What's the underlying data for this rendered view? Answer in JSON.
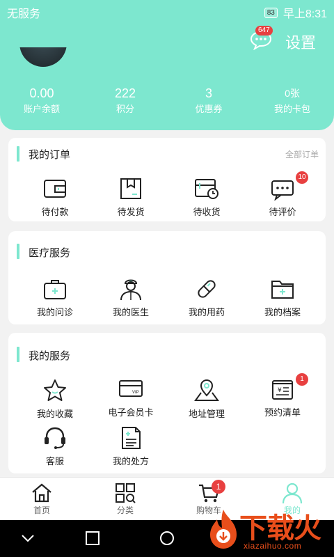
{
  "status_bar": {
    "carrier": "无服务",
    "battery": "83",
    "time": "早上8:31"
  },
  "header": {
    "message_badge": "647",
    "settings_label": "设置",
    "stats": [
      {
        "value": "0.00",
        "label": "账户余额"
      },
      {
        "value": "222",
        "label": "积分"
      },
      {
        "value": "3",
        "label": "优惠券"
      },
      {
        "value": "0张",
        "label": "我的卡包"
      }
    ]
  },
  "orders": {
    "title": "我的订单",
    "more": "全部订单",
    "items": [
      {
        "label": "待付款",
        "icon": "wallet-icon"
      },
      {
        "label": "待发货",
        "icon": "package-icon"
      },
      {
        "label": "待收货",
        "icon": "delivery-clock-icon"
      },
      {
        "label": "待评价",
        "icon": "comment-icon",
        "badge": "10"
      }
    ]
  },
  "medical": {
    "title": "医疗服务",
    "items": [
      {
        "label": "我的问诊",
        "icon": "medical-kit-icon"
      },
      {
        "label": "我的医生",
        "icon": "doctor-icon"
      },
      {
        "label": "我的用药",
        "icon": "pill-icon"
      },
      {
        "label": "我的档案",
        "icon": "folder-icon"
      }
    ]
  },
  "services": {
    "title": "我的服务",
    "items": [
      {
        "label": "我的收藏",
        "icon": "star-icon"
      },
      {
        "label": "电子会员卡",
        "icon": "vip-card-icon"
      },
      {
        "label": "地址管理",
        "icon": "location-icon"
      },
      {
        "label": "预约清单",
        "icon": "receipt-icon",
        "badge": "1"
      },
      {
        "label": "客服",
        "icon": "headset-icon"
      },
      {
        "label": "我的处方",
        "icon": "prescription-icon"
      }
    ]
  },
  "tabbar": {
    "tabs": [
      {
        "label": "首页",
        "icon": "home-icon"
      },
      {
        "label": "分类",
        "icon": "category-icon"
      },
      {
        "label": "购物车",
        "icon": "cart-icon",
        "badge": "1"
      },
      {
        "label": "我的",
        "icon": "user-icon",
        "active": true
      }
    ]
  },
  "watermark": {
    "main": "下载火",
    "sub": "xiazaihuo.com"
  },
  "colors": {
    "accent": "#7de7cf",
    "badge": "#e84040",
    "watermark": "#e84e1b"
  }
}
